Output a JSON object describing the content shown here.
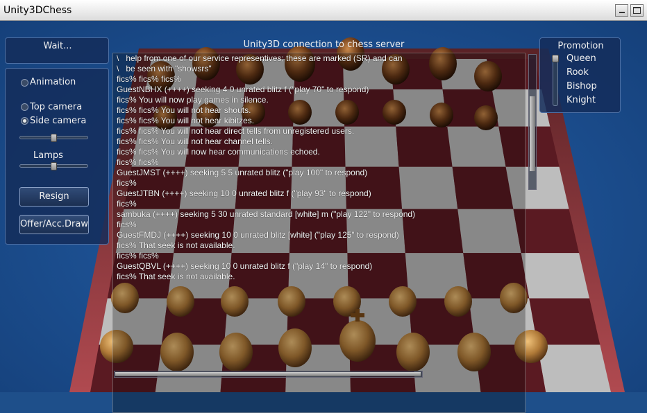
{
  "window": {
    "title": "Unity3DChess"
  },
  "left_panel": {
    "status_label": "Wait...",
    "animation_label": "Animation",
    "top_camera_label": "Top camera",
    "side_camera_label": "Side camera",
    "lamps_label": "Lamps",
    "resign_label": "Resign",
    "draw_label": "Offer/Acc.Draw",
    "animation_checked": false,
    "camera_selected": "Side camera",
    "camera_slider_fraction": 0.5,
    "lamps_slider_fraction": 0.5
  },
  "promotion": {
    "title": "Promotion",
    "options": [
      "Queen",
      "Rook",
      "Bishop",
      "Knight"
    ],
    "selected": "Queen"
  },
  "console": {
    "title": "Unity3D connection to chess server",
    "lines": [
      "\\   help from one of our service representives; these are marked (SR) and can",
      "\\   be seen with \"showsrs\"",
      "fics% fics% fics%",
      "GuestNBHX (++++) seeking 4 0 unrated blitz f (\"play 70\" to respond)",
      "fics% You will now play games in silence.",
      "fics% fics% You will not hear shouts.",
      "fics% fics% You will not hear kibitzes.",
      "fics% fics% You will not hear direct tells from unregistered users.",
      "fics% fics% You will not hear channel tells.",
      "fics% fics% You will now hear communications echoed.",
      "fics% fics%",
      "GuestJMST (++++) seeking 5 5 unrated blitz (\"play 100\" to respond)",
      "fics%",
      "GuestJTBN (++++) seeking 10 0 unrated blitz f (\"play 93\" to respond)",
      "fics%",
      "sambuka (++++) seeking 5 30 unrated standard [white] m (\"play 122\" to respond)",
      "fics%",
      "GuestFMDJ (++++) seeking 10 0 unrated blitz [white] (\"play 125\" to respond)",
      "fics% That seek is not available.",
      "fics% fics%",
      "GuestQBVL (++++) seeking 10 0 unrated blitz f (\"play 14\" to respond)",
      "fics% That seek is not available."
    ]
  },
  "colors": {
    "desktop": "#1e4f8a",
    "board_dark": "#5a1a22",
    "board_light": "#bdbdbd",
    "pieces": "#c08a48"
  }
}
